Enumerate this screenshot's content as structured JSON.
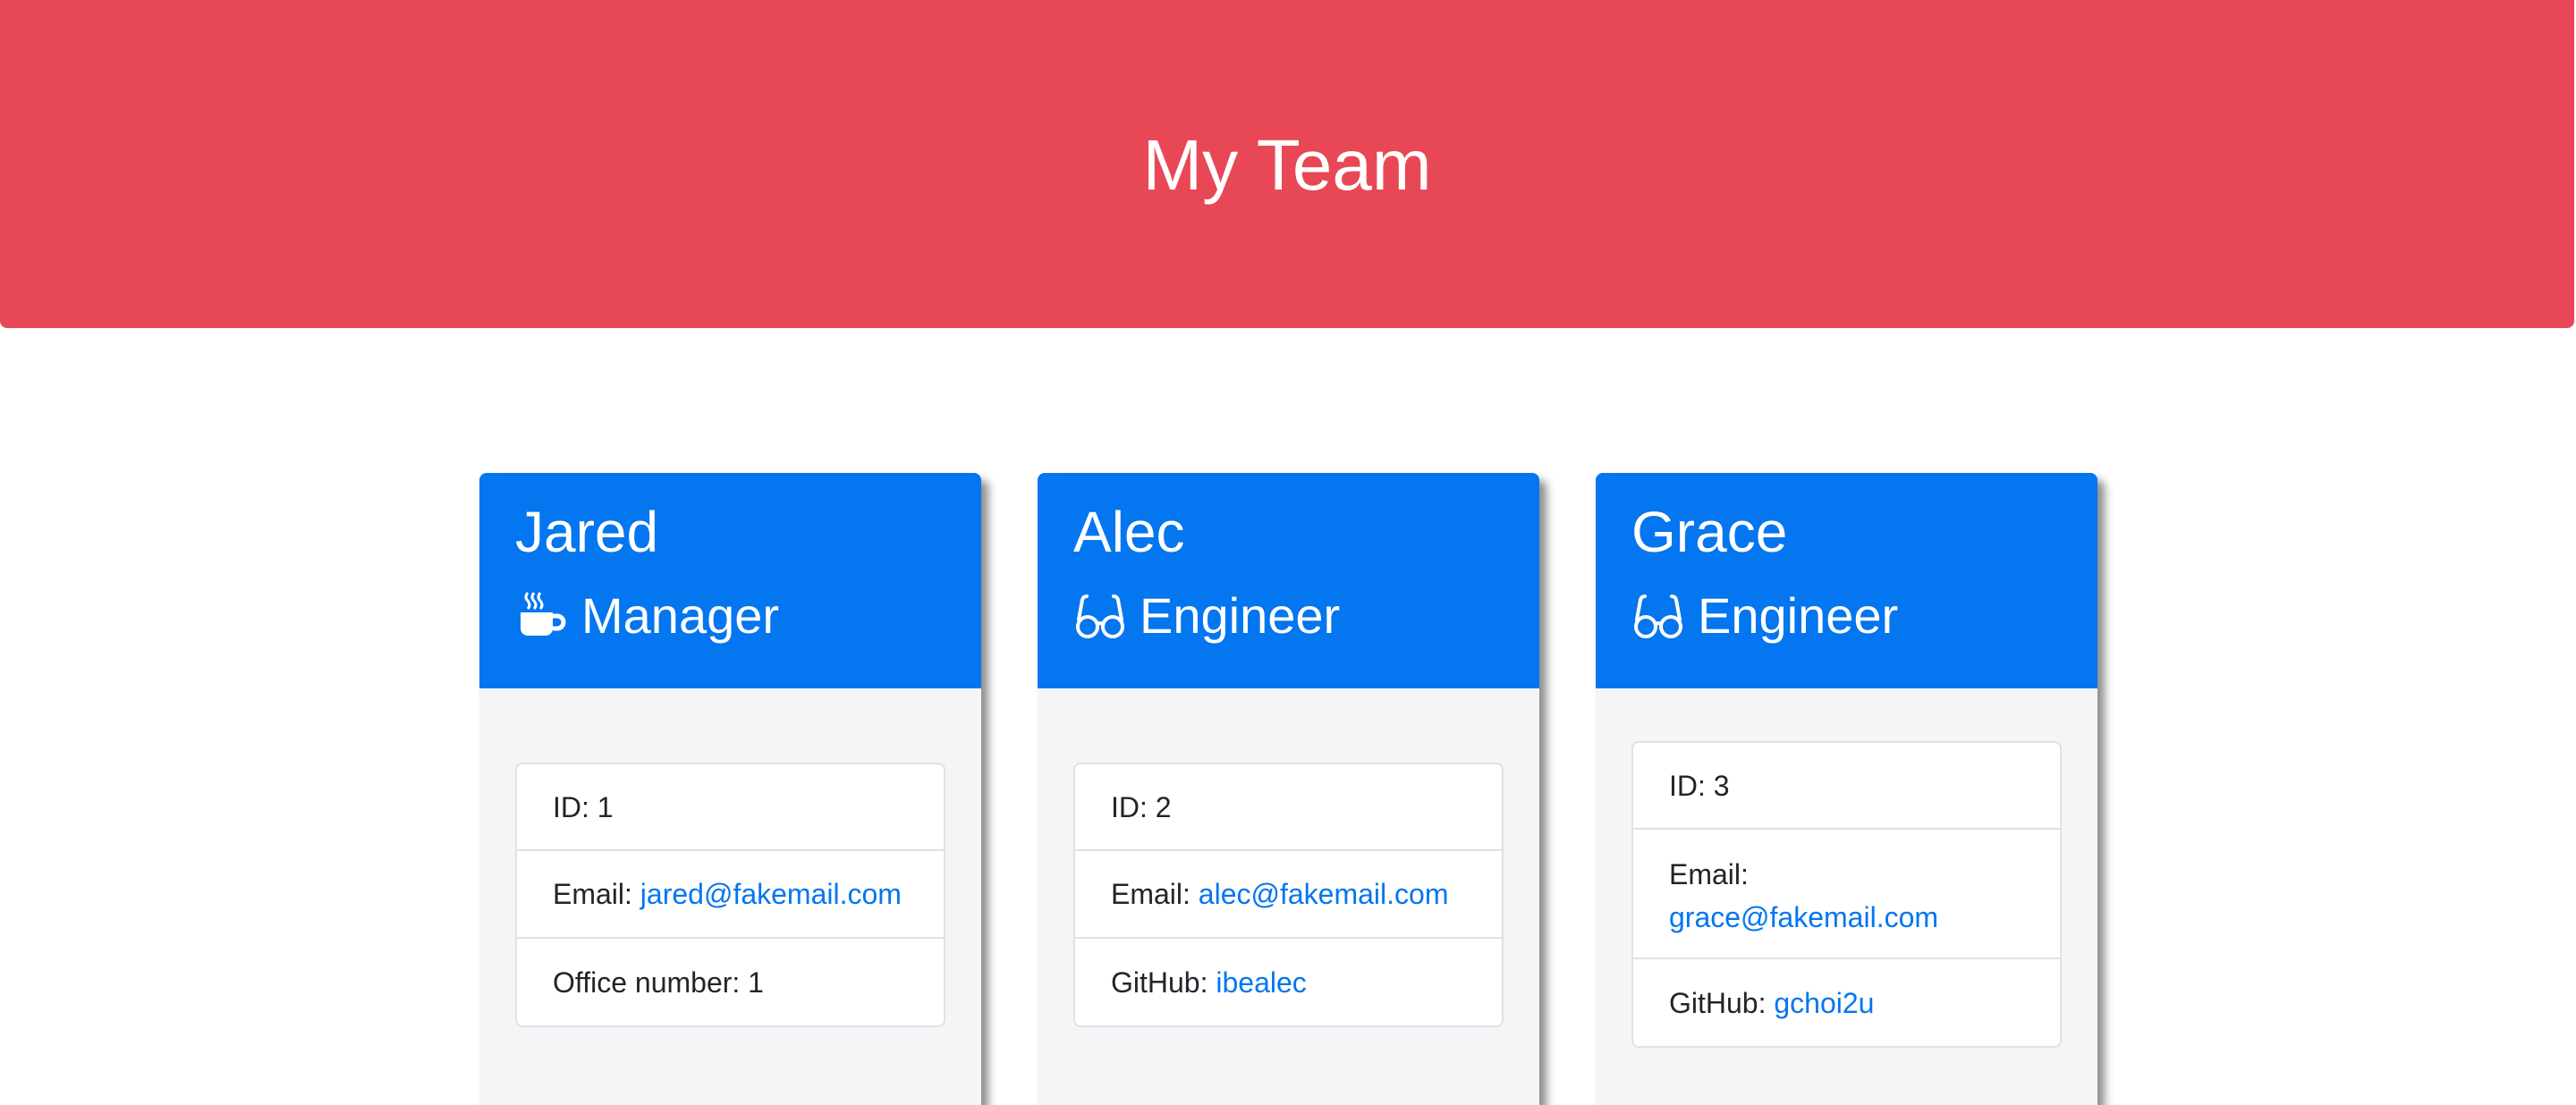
{
  "header": {
    "title": "My Team"
  },
  "colors": {
    "banner": "#e84855",
    "card_header": "#0376f0",
    "link": "#0376f0"
  },
  "cards": [
    {
      "name": "Jared",
      "role": "Manager",
      "role_icon": "coffee-mug-icon",
      "id_label": "ID: ",
      "id": "1",
      "email_label": "Email: ",
      "email": "jared@fakemail.com",
      "extra_label": "Office number: ",
      "extra_value": "1"
    },
    {
      "name": "Alec",
      "role": "Engineer",
      "role_icon": "glasses-icon",
      "id_label": "ID: ",
      "id": "2",
      "email_label": "Email: ",
      "email": "alec@fakemail.com",
      "extra_label": "GitHub: ",
      "extra_value": "ibealec"
    },
    {
      "name": "Grace",
      "role": "Engineer",
      "role_icon": "glasses-icon",
      "id_label": "ID: ",
      "id": "3",
      "email_label": "Email:",
      "email": "grace@fakemail.com",
      "extra_label": "GitHub: ",
      "extra_value": "gchoi2u"
    }
  ]
}
